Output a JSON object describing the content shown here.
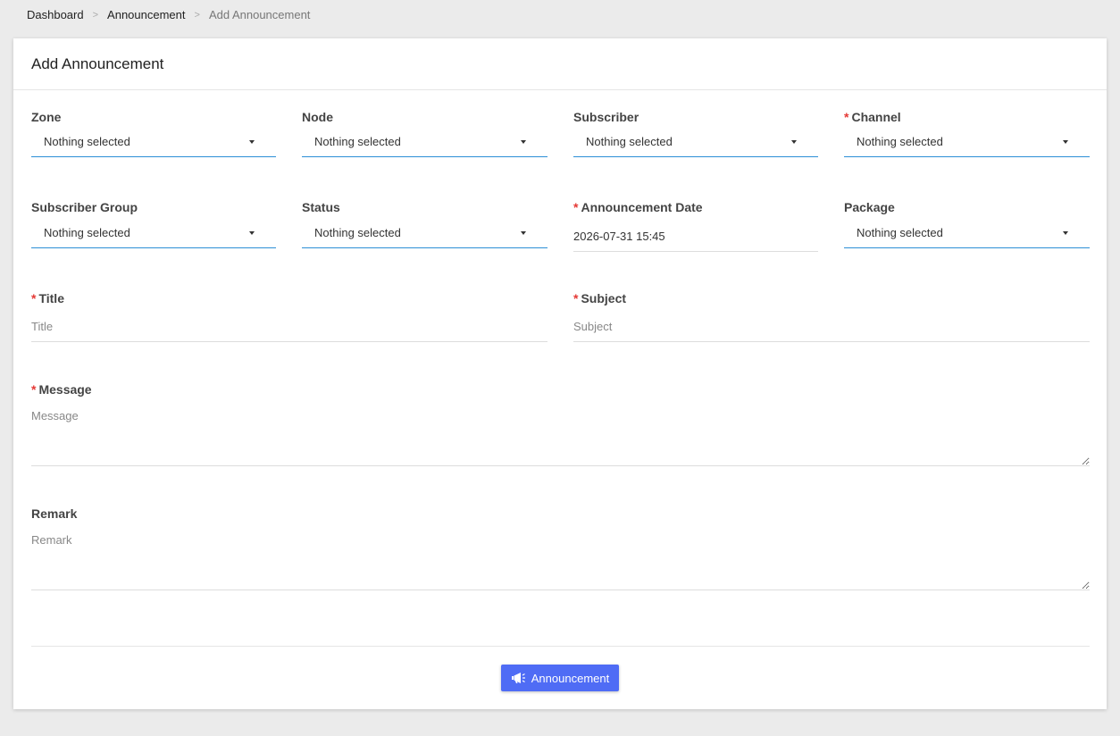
{
  "breadcrumb": {
    "items": [
      "Dashboard",
      "Announcement",
      "Add Announcement"
    ],
    "separator": ">"
  },
  "card": {
    "title": "Add Announcement"
  },
  "form": {
    "required_marker": "*",
    "zone": {
      "label": "Zone",
      "value": "Nothing selected"
    },
    "node": {
      "label": "Node",
      "value": "Nothing selected"
    },
    "subscriber": {
      "label": "Subscriber",
      "value": "Nothing selected"
    },
    "channel": {
      "label": "Channel",
      "value": "Nothing selected"
    },
    "subscriber_group": {
      "label": "Subscriber Group",
      "value": "Nothing selected"
    },
    "status": {
      "label": "Status",
      "value": "Nothing selected"
    },
    "announcement_date": {
      "label": "Announcement Date",
      "value": "2026-07-31 15:45"
    },
    "package": {
      "label": "Package",
      "value": "Nothing selected"
    },
    "title": {
      "label": "Title",
      "placeholder": "Title"
    },
    "subject": {
      "label": "Subject",
      "placeholder": "Subject"
    },
    "message": {
      "label": "Message",
      "placeholder": "Message"
    },
    "remark": {
      "label": "Remark",
      "placeholder": "Remark"
    }
  },
  "submit": {
    "label": "Announcement",
    "icon": "megaphone-icon"
  },
  "colors": {
    "accent": "#2c8fd6",
    "button": "#4f6cf5",
    "required": "#e53935"
  }
}
